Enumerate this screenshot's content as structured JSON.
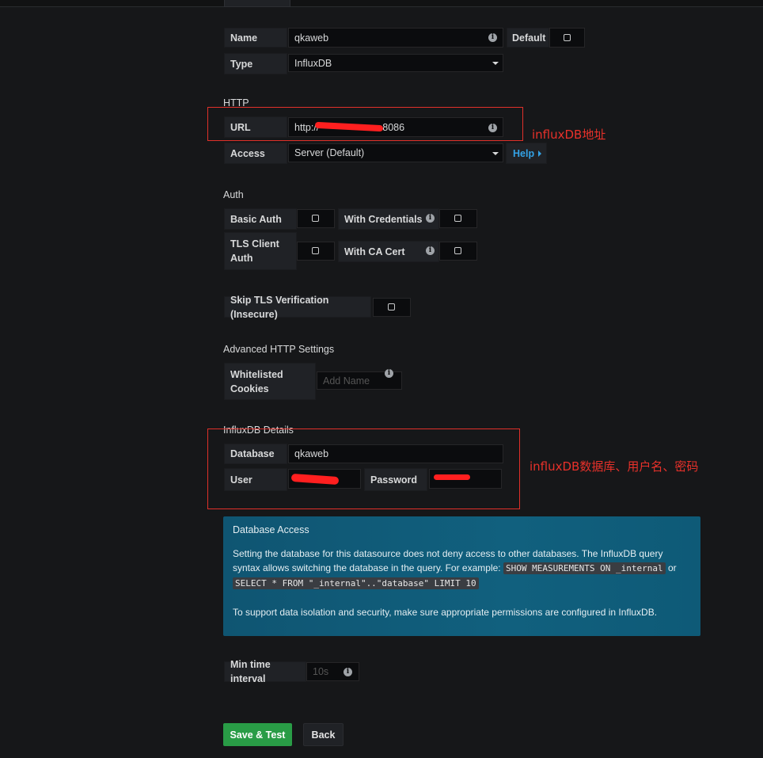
{
  "settings": {
    "name_label": "Name",
    "name_value": "qkaweb",
    "default_label": "Default",
    "type_label": "Type",
    "type_value": "InfluxDB"
  },
  "http": {
    "section_title": "HTTP",
    "url_label": "URL",
    "url_value_prefix": "http://",
    "url_value_suffix": "8086",
    "access_label": "Access",
    "access_value": "Server (Default)",
    "help_label": "Help"
  },
  "auth": {
    "section_title": "Auth",
    "basic_auth_label": "Basic Auth",
    "with_credentials_label": "With Credentials",
    "tls_client_auth_label": "TLS Client Auth",
    "with_ca_cert_label": "With CA Cert",
    "skip_tls_label": "Skip TLS Verification (Insecure)"
  },
  "advanced": {
    "section_title": "Advanced HTTP Settings",
    "whitelisted_cookies_label": "Whitelisted Cookies",
    "add_name_placeholder": "Add Name"
  },
  "influx": {
    "section_title": "InfluxDB Details",
    "database_label": "Database",
    "database_value": "qkaweb",
    "user_label": "User",
    "password_label": "Password"
  },
  "db_access": {
    "title": "Database Access",
    "text_1": "Setting the database for this datasource does not deny access to other databases. The InfluxDB query syntax allows switching the database in the query. For example:",
    "code_1": "SHOW MEASUREMENTS ON _internal",
    "or": "or",
    "code_2": "SELECT * FROM \"_internal\"..\"database\" LIMIT 10",
    "text_2": "To support data isolation and security, make sure appropriate permissions are configured in InfluxDB."
  },
  "min_interval": {
    "label": "Min time interval",
    "placeholder": "10s"
  },
  "buttons": {
    "save_test": "Save & Test",
    "back": "Back"
  },
  "annotations": {
    "url_note": "influxDB地址",
    "db_note": "influxDB数据库、用户名、密码"
  },
  "colors": {
    "background": "#161719",
    "annotation_red": "#e8312a",
    "save_green": "#299c46",
    "info_box_blue": "#11607e",
    "help_link_blue": "#33a2e5"
  }
}
